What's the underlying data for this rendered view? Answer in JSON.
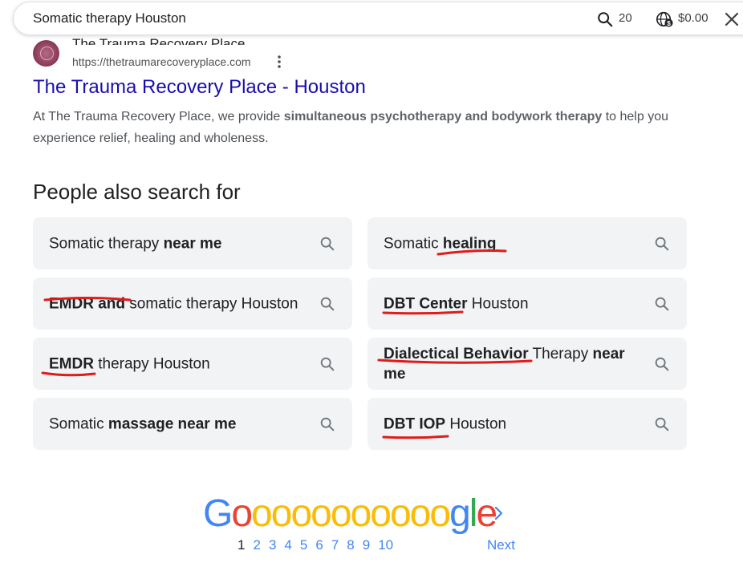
{
  "search": {
    "query": "Somatic therapy Houston",
    "result_count": "20",
    "cost": "$0.00",
    "search_icon": "search-icon",
    "globe_icon": "globe-dollar-icon",
    "close_icon": "close-icon"
  },
  "result": {
    "site_name": "The Trauma Recovery Place",
    "url": "https://thetraumarecoveryplace.com",
    "title": "The Trauma Recovery Place - Houston",
    "snippet_pre": "At The Trauma Recovery Place, we provide ",
    "snippet_bold": "simultaneous psychotherapy and bodywork therapy",
    "snippet_post": " to help you experience relief, healing and wholeness.",
    "menu_icon": "kebab-menu-icon"
  },
  "people_also_search": {
    "heading": "People also search for",
    "items": [
      {
        "pre": "Somatic therapy ",
        "bold": "near me",
        "post": ""
      },
      {
        "pre": "Somatic ",
        "bold": "healing",
        "post": ""
      },
      {
        "pre": "",
        "bold": "EMDR and",
        "post": " somatic therapy Houston"
      },
      {
        "pre": "",
        "bold": "DBT Center",
        "post": " Houston"
      },
      {
        "pre": "",
        "bold": "EMDR",
        "post": " therapy Houston"
      },
      {
        "pre": "",
        "bold": "Dialectical Behavior",
        "post": " Therapy ",
        "bold2": "near me"
      },
      {
        "pre": "Somatic ",
        "bold": "massage near me",
        "post": ""
      },
      {
        "pre": "",
        "bold": "DBT IOP",
        "post": " Houston"
      }
    ]
  },
  "pagination": {
    "logo_letters": [
      "G",
      "o",
      "o",
      "o",
      "o",
      "o",
      "o",
      "o",
      "o",
      "o",
      "o",
      "o",
      "g",
      "l",
      "e"
    ],
    "pages": [
      "1",
      "2",
      "3",
      "4",
      "5",
      "6",
      "7",
      "8",
      "9",
      "10"
    ],
    "current_page": "1",
    "next_label": "Next"
  },
  "colors": {
    "link": "#1a0dab",
    "page_link": "#4285f4",
    "chip_bg": "#f1f3f4",
    "annotation": "#e01b1b",
    "google_blue": "#4285f4",
    "google_red": "#ea4335",
    "google_yellow": "#fbbc05",
    "google_green": "#34a853"
  }
}
